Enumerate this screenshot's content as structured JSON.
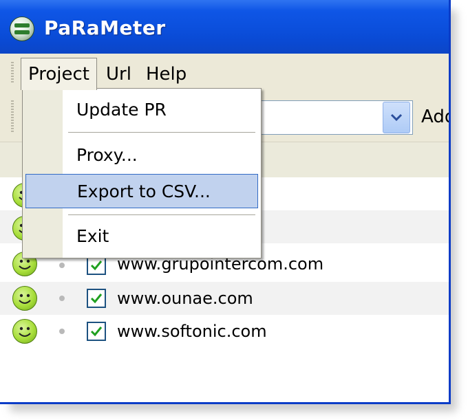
{
  "window": {
    "title": "PaRaMeter"
  },
  "menubar": {
    "items": [
      "Project",
      "Url",
      "Help"
    ]
  },
  "project_menu": {
    "items": [
      {
        "label": "Update PR"
      },
      {
        "label": "Proxy..."
      },
      {
        "label": "Export to CSV..."
      },
      {
        "label": "Exit"
      }
    ],
    "highlighted": "Export to CSV..."
  },
  "toolbar": {
    "add_label": "Add"
  },
  "sites": [
    {
      "url": "www.grupointercom.com",
      "checked": true
    },
    {
      "url": "www.ounae.com",
      "checked": true
    },
    {
      "url": "www.softonic.com",
      "checked": true
    }
  ],
  "colors": {
    "titlebar": "#0b4fdc",
    "menu_highlight": "#c1d2ee",
    "menu_highlight_border": "#316ac5",
    "status_ok": "#a8de3a",
    "checkmark": "#1fa01f"
  }
}
